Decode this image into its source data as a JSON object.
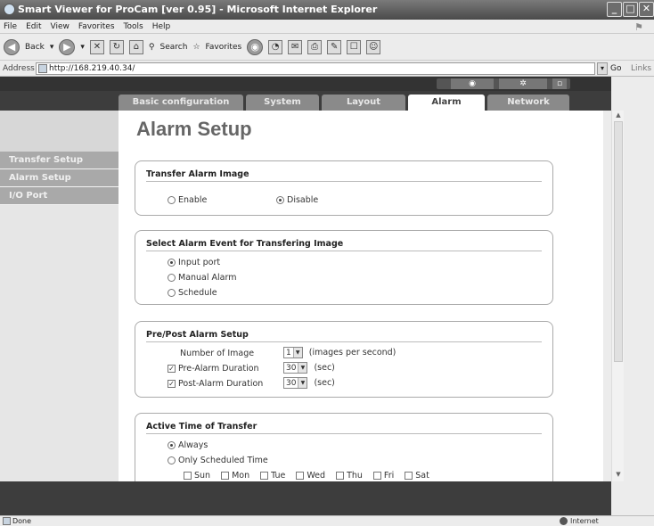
{
  "window": {
    "title": "Smart Viewer for ProCam [ver 0.95] - Microsoft Internet Explorer",
    "controls": {
      "minimize": "_",
      "maximize": "□",
      "close": "✕"
    }
  },
  "menu": [
    "File",
    "Edit",
    "View",
    "Favorites",
    "Tools",
    "Help"
  ],
  "toolbar": {
    "back": "Back",
    "search": "Search",
    "favorites": "Favorites"
  },
  "address": {
    "label": "Address",
    "url": "http://168.219.40.34/",
    "go": "Go",
    "links": "Links"
  },
  "tabs": [
    {
      "label": "Basic configuration",
      "active": false
    },
    {
      "label": "System",
      "active": false
    },
    {
      "label": "Layout",
      "active": false
    },
    {
      "label": "Alarm",
      "active": true
    },
    {
      "label": "Network",
      "active": false
    }
  ],
  "sidebar": {
    "items": [
      {
        "label": "Transfer Setup"
      },
      {
        "label": "Alarm Setup"
      },
      {
        "label": "I/O Port"
      }
    ]
  },
  "page_title": "Alarm Setup",
  "transfer_alarm_image": {
    "title": "Transfer Alarm Image",
    "enable": "Enable",
    "disable": "Disable",
    "selected": "Disable"
  },
  "alarm_event": {
    "title": "Select Alarm Event for Transfering Image",
    "options": [
      "Input port",
      "Manual Alarm",
      "Schedule"
    ],
    "selected": "Input port"
  },
  "pre_post": {
    "title": "Pre/Post Alarm Setup",
    "number_of_image_label": "Number of Image",
    "number_of_image_value": "1",
    "number_of_image_unit": "(images per second)",
    "pre_label": "Pre-Alarm Duration",
    "pre_value": "30",
    "pre_unit": "(sec)",
    "pre_checked": true,
    "post_label": "Post-Alarm Duration",
    "post_value": "30",
    "post_unit": "(sec)",
    "post_checked": true
  },
  "active_time": {
    "title": "Active Time of Transfer",
    "always": "Always",
    "scheduled": "Only Scheduled Time",
    "selected": "Always",
    "days": [
      "Sun",
      "Mon",
      "Tue",
      "Wed",
      "Thu",
      "Fri",
      "Sat"
    ]
  },
  "status": {
    "left": "Done",
    "zone": "Internet"
  }
}
